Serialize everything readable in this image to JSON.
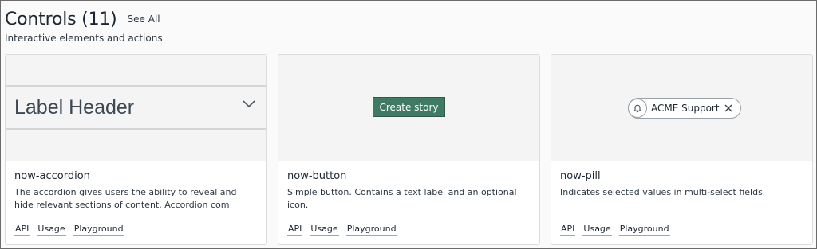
{
  "header": {
    "title": "Controls (11)",
    "see_all": "See All",
    "subtitle": "Interactive elements and actions"
  },
  "cards": [
    {
      "name": "now-accordion",
      "description": "The accordion gives users the ability to reveal and hide relevant sections of content. Accordion com",
      "preview": {
        "label_header": "Label Header",
        "icon": "chevron-down-icon"
      },
      "links": [
        "API",
        "Usage",
        "Playground"
      ]
    },
    {
      "name": "now-button",
      "description": "Simple button. Contains a text label and an optional icon.",
      "preview": {
        "button_label": "Create story"
      },
      "links": [
        "API",
        "Usage",
        "Playground"
      ]
    },
    {
      "name": "now-pill",
      "description": "Indicates selected values in multi-select fields.",
      "preview": {
        "pill_label": "ACME Support",
        "icons": [
          "bell-icon",
          "close-icon"
        ]
      },
      "links": [
        "API",
        "Usage",
        "Playground"
      ]
    }
  ],
  "colors": {
    "accent": "#3f7b64",
    "link_underline": "#7fb8a3",
    "preview_bg": "#f4f4f4"
  }
}
